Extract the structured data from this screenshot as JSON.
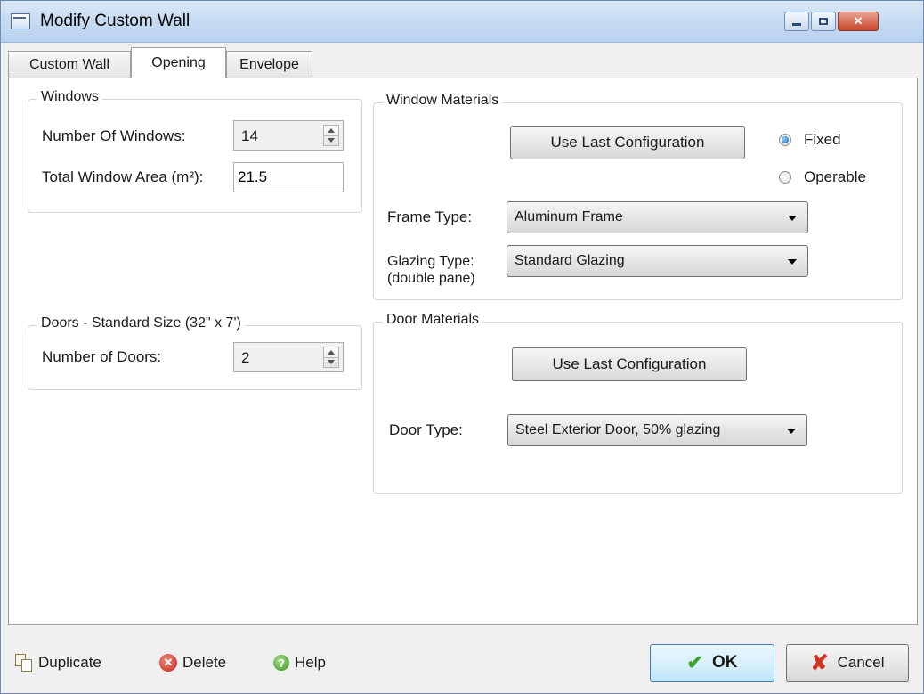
{
  "window": {
    "title": "Modify Custom Wall",
    "close_glyph": "✕",
    "icon": "wall-app-icon"
  },
  "tabs": [
    {
      "label": "Custom Wall"
    },
    {
      "label": "Opening"
    },
    {
      "label": "Envelope"
    }
  ],
  "windows": {
    "title": "Windows",
    "count_label": "Number Of Windows:",
    "count_value": "14",
    "area_label": "Total Window Area (m²):",
    "area_value": "21.5"
  },
  "doors": {
    "title": "Doors - Standard Size (32\" x 7')",
    "count_label": "Number of Doors:",
    "count_value": "2"
  },
  "window_materials": {
    "title": "Window Materials",
    "use_last_label": "Use Last Configuration",
    "radio_fixed": "Fixed",
    "radio_operable": "Operable",
    "selected": "Fixed",
    "frame_label": "Frame Type:",
    "frame_value": "Aluminum Frame",
    "glazing_label": "Glazing Type:",
    "glazing_sublabel": "(double pane)",
    "glazing_value": "Standard Glazing"
  },
  "door_materials": {
    "title": "Door Materials",
    "use_last_label": "Use Last Configuration",
    "door_type_label": "Door Type:",
    "door_type_value": "Steel Exterior Door, 50% glazing"
  },
  "footer": {
    "duplicate": "Duplicate",
    "delete": "Delete",
    "help": "Help",
    "ok": "OK",
    "cancel": "Cancel",
    "ok_glyph": "✔",
    "cancel_glyph": "✘",
    "delete_glyph": "✕",
    "help_glyph": "?"
  }
}
